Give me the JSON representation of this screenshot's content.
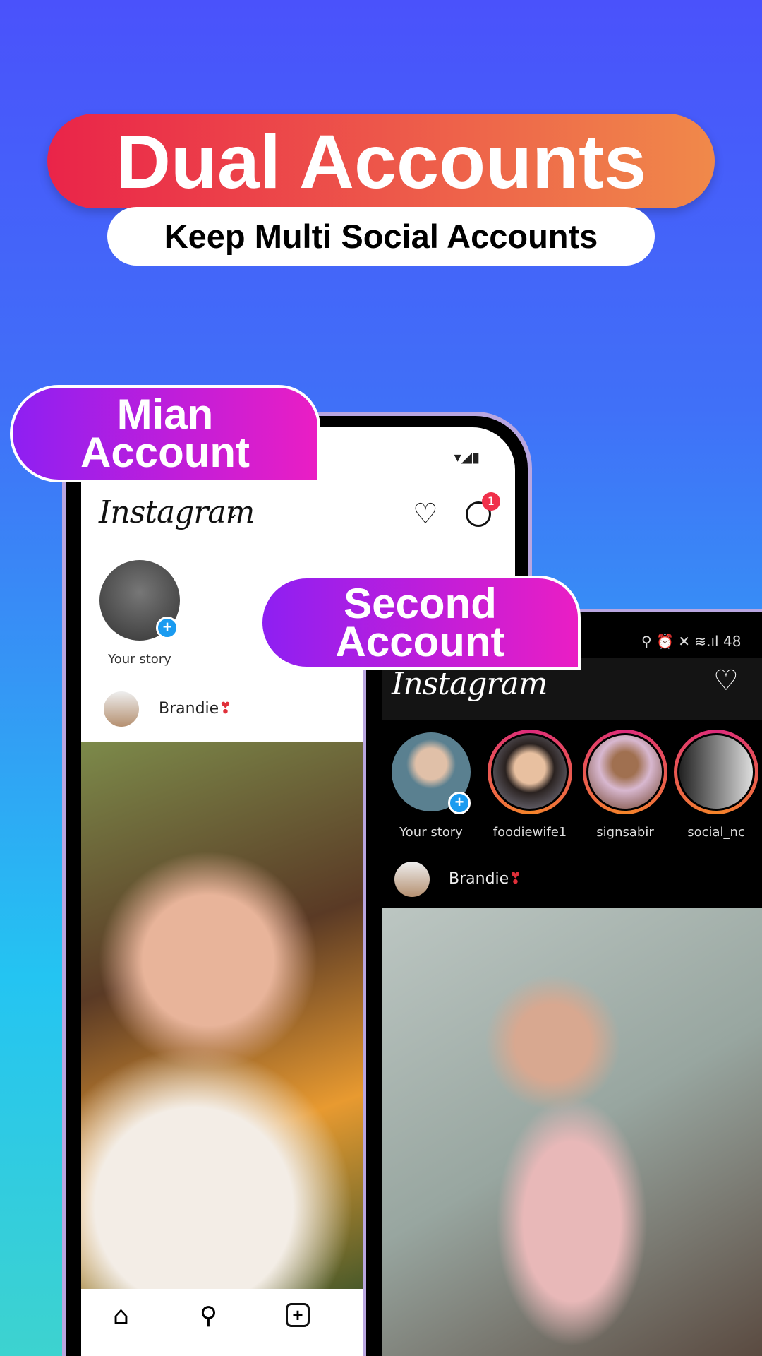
{
  "header": {
    "title": "Dual Accounts",
    "subtitle": "Keep Multi Social Accounts"
  },
  "main_account": {
    "badge": "Mian\nAccount",
    "badge_line1": "Mian",
    "badge_line2": "Account",
    "app_logo": "Instagram",
    "messenger_badge": "1",
    "stories": [
      {
        "label": "Your story"
      }
    ],
    "post_user": "Brandie",
    "post_emoji": "❣",
    "nav": [
      "home-icon",
      "search-icon",
      "add-icon"
    ]
  },
  "second_account": {
    "badge_line1": "Second",
    "badge_line2": "Account",
    "app_logo": "Instagram",
    "status_battery": "48",
    "stories": [
      {
        "label": "Your story"
      },
      {
        "label": "foodiewife1"
      },
      {
        "label": "signsabir"
      },
      {
        "label": "social_nc"
      }
    ],
    "post_user": "Brandie",
    "post_emoji": "❣"
  },
  "colors": {
    "title_gradient": [
      "#ea2449",
      "#f0894a"
    ],
    "label_gradient": [
      "#8e1ff2",
      "#ea1ec4"
    ],
    "story_ring": [
      "#f58529",
      "#dd2a7b"
    ],
    "plus_blue": "#1a9bf0"
  }
}
